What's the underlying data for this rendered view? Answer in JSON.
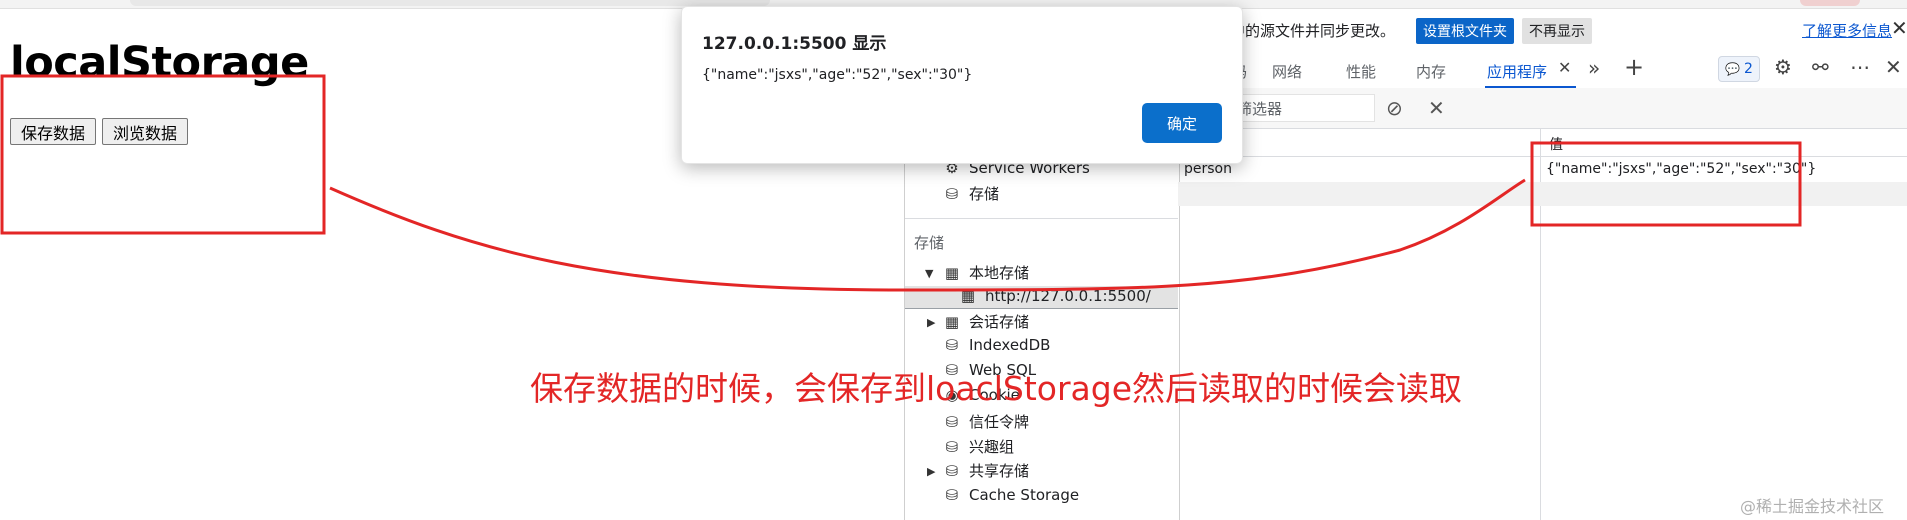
{
  "page": {
    "title": "localStorage",
    "save_button": "保存数据",
    "browse_button": "浏览数据"
  },
  "devtools": {
    "infobar": {
      "partial_text": "中的源文件并同步更改。",
      "set_root_button": "设置根文件夹",
      "dont_show_button": "不再显示",
      "learn_more_link": "了解更多信息"
    },
    "tabs": [
      "码",
      "网络",
      "性能",
      "内存",
      "应用程序"
    ],
    "active_tab": "应用程序",
    "issues_count": "2",
    "filter_placeholder": "筛选器",
    "tree": {
      "service_workers": "Service Workers",
      "storage_top": "存储",
      "section_storage": "存储",
      "local_storage": "本地存储",
      "local_origin": "http://127.0.0.1:5500/",
      "session_storage": "会话存储",
      "indexeddb": "IndexedDB",
      "websql": "Web SQL",
      "cookie": "Cookie",
      "trust_tokens": "信任令牌",
      "interest_groups": "兴趣组",
      "shared_storage": "共享存储",
      "cache_storage": "Cache Storage"
    },
    "table": {
      "value_header": "值",
      "rows": [
        {
          "key": "person",
          "value": "{\"name\":\"jsxs\",\"age\":\"52\",\"sex\":\"30\"}"
        }
      ]
    }
  },
  "dialog": {
    "title": "127.0.0.1:5500 显示",
    "message": "{\"name\":\"jsxs\",\"age\":\"52\",\"sex\":\"30\"}",
    "ok_button": "确定"
  },
  "annotation": {
    "text": "保存数据的时候，会保存到loaclStorage然后读取的时候会读取",
    "color": "#e32626"
  },
  "watermark": "@稀土掘金技术社区",
  "colors": {
    "accent_blue": "#0b57d0",
    "dialog_button": "#0b6fcb",
    "annotation_red": "#e32626"
  }
}
